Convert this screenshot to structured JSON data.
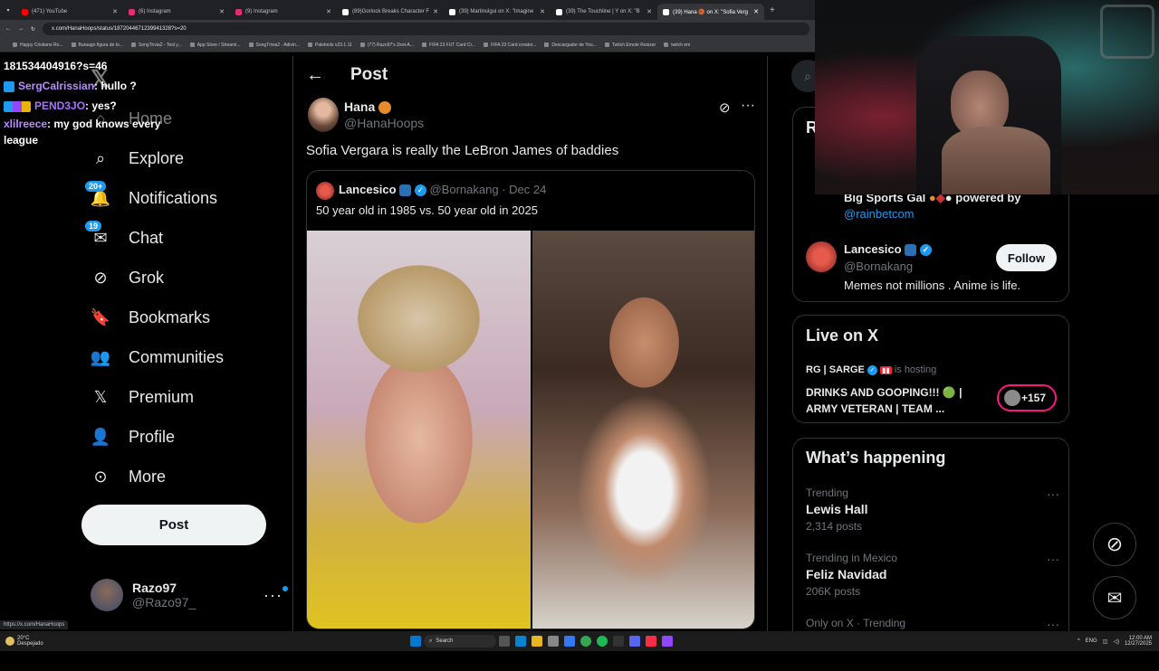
{
  "browser": {
    "tabs": [
      {
        "title": "(471) YouTube",
        "color": "#ff0000",
        "active": false
      },
      {
        "title": "(6) Instagram",
        "color": "#e1306c",
        "active": false
      },
      {
        "title": "(9) Instagram",
        "color": "#e1306c",
        "active": false
      },
      {
        "title": "(89)Gorlock Breaks Character F",
        "color": "#ffffff",
        "active": false
      },
      {
        "title": "(39) Martinslgui on X: \"Imagine",
        "color": "#ffffff",
        "active": false
      },
      {
        "title": "(39) The Touchline | Y on X: \"B",
        "color": "#ffffff",
        "active": false
      },
      {
        "title": "(39) Hana 🏀 on X: \"Sofia Verg",
        "color": "#ffffff",
        "active": true
      }
    ],
    "new_tab": "+",
    "url": "x.com/HanaHoops/status/1872044671239941328?s=20",
    "bookmarks": [
      "Happy Cristiano Ro...",
      "Buraago figura de to...",
      "SongTrivia2 - Test y...",
      "App Store / Streami...",
      "SongTrivia2 - Adivin...",
      "Paletools v23.1.11",
      "(77) Razo97's Zest-A...",
      "FIFA 23 FUT Card Cr...",
      "FIFA 23 Card creator...",
      "Descargador de You...",
      "Twitch Emote Resizer",
      "twitch em"
    ]
  },
  "stream_chat": [
    {
      "user": "",
      "text": "181534404916?s=46"
    },
    {
      "user": "SergCalrissian",
      "text": ": hullo ?"
    },
    {
      "user": "PEND3JO",
      "text": ": yes?"
    },
    {
      "user": "xlilreece",
      "text": ": my god knows every league"
    }
  ],
  "nav": {
    "items": [
      {
        "label": "Home",
        "icon": "home-icon"
      },
      {
        "label": "Explore",
        "icon": "search-icon"
      },
      {
        "label": "Notifications",
        "icon": "bell-icon",
        "badge": "20+"
      },
      {
        "label": "Chat",
        "icon": "mail-icon",
        "badge": "19"
      },
      {
        "label": "Grok",
        "icon": "grok-icon"
      },
      {
        "label": "Bookmarks",
        "icon": "bookmark-icon"
      },
      {
        "label": "Communities",
        "icon": "communities-icon"
      },
      {
        "label": "Premium",
        "icon": "x-logo-icon"
      },
      {
        "label": "Profile",
        "icon": "person-icon"
      },
      {
        "label": "More",
        "icon": "more-circle-icon"
      }
    ],
    "post_button": "Post",
    "account": {
      "name": "Razo97",
      "handle": "@Razo97_"
    }
  },
  "post": {
    "header": "Post",
    "author": {
      "name": "Hana",
      "handle": "@HanaHoops"
    },
    "text": "Sofia Vergara is really the LeBron James of baddies",
    "quote": {
      "name": "Lancesico",
      "handle": "@Bornakang",
      "date": "Dec 24",
      "text": "50 year old in 1985 vs. 50 year old in 2025"
    }
  },
  "right": {
    "profile_card": {
      "bio_line1": "Big Sports Gal",
      "bio_powered": "powered by",
      "bio_link": "@rainbetcom",
      "heading_initial": "R"
    },
    "who_to_follow": {
      "name": "Lancesico",
      "handle": "@Bornakang",
      "bio": "Memes not millions . Anime is life.",
      "follow": "Follow"
    },
    "live": {
      "title": "Live on X",
      "host": "RG | SARGE",
      "hosting": "is hosting",
      "stream_title": "DRINKS AND GOOPING!!! 🟢 | ARMY VETERAN | TEAM ...",
      "listeners": "+157"
    },
    "happening": {
      "title": "What’s happening",
      "trends": [
        {
          "context": "Trending",
          "name": "Lewis Hall",
          "count": "2,314 posts"
        },
        {
          "context": "Trending in Mexico",
          "name": "Feliz Navidad",
          "count": "206K posts"
        },
        {
          "context": "Only on X · Trending",
          "name": "",
          "count": ""
        }
      ]
    }
  },
  "status_bar": {
    "link": "https://x.com/HanaHoops"
  },
  "taskbar": {
    "weather_temp": "20°C",
    "weather_desc": "Despejado",
    "search": "Search",
    "lang": "ENG",
    "time": "12:00 AM",
    "date": "12/27/2025"
  }
}
